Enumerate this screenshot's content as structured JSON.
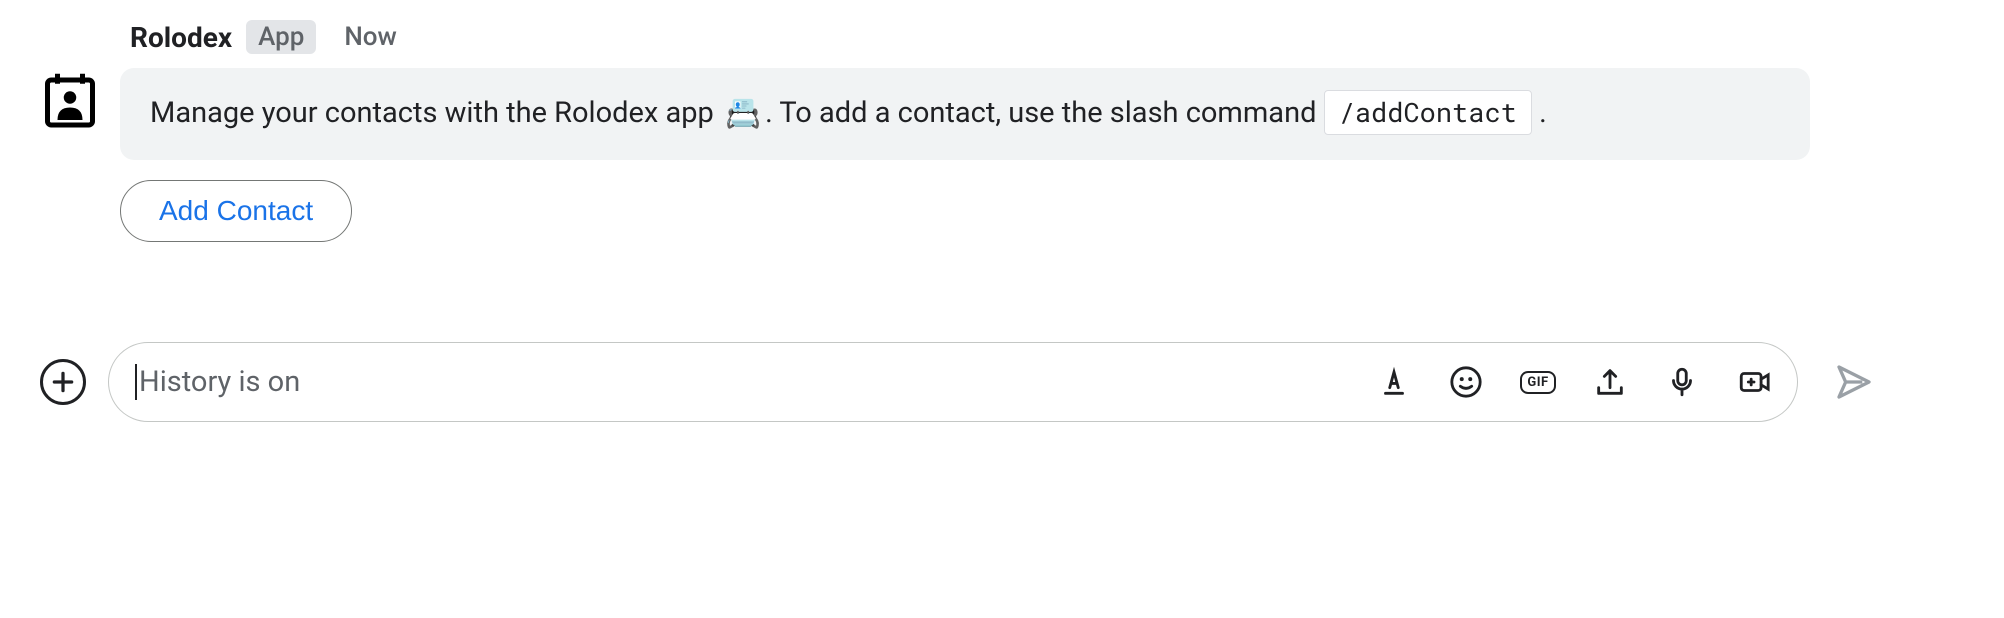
{
  "message": {
    "app_name": "Rolodex",
    "app_badge": "App",
    "timestamp": "Now",
    "text_before_emoji": "Manage your contacts with the Rolodex app ",
    "emoji": "📇",
    "text_after_emoji": ". To add a contact, use the slash command ",
    "command_code": "/addContact",
    "text_after_code": " .",
    "action_button_label": "Add Contact"
  },
  "compose": {
    "placeholder": "History is on",
    "gif_label": "GIF"
  }
}
